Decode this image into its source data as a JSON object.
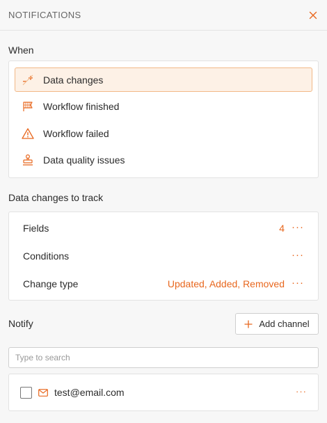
{
  "header": {
    "title": "NOTIFICATIONS",
    "close_icon": "close-icon"
  },
  "when": {
    "label": "When",
    "items": [
      {
        "label": "Data changes",
        "icon": "data-changes-icon",
        "selected": true
      },
      {
        "label": "Workflow finished",
        "icon": "flag-icon",
        "selected": false
      },
      {
        "label": "Workflow failed",
        "icon": "warning-icon",
        "selected": false
      },
      {
        "label": "Data quality issues",
        "icon": "stamp-icon",
        "selected": false
      }
    ]
  },
  "track": {
    "label": "Data changes to track",
    "rows": [
      {
        "label": "Fields",
        "value": "4"
      },
      {
        "label": "Conditions",
        "value": ""
      },
      {
        "label": "Change type",
        "value": "Updated, Added, Removed"
      }
    ],
    "more": "···"
  },
  "notify": {
    "label": "Notify",
    "add_channel_label": "Add channel",
    "search_placeholder": "Type to search",
    "channels": [
      {
        "email": "test@email.com",
        "checked": false
      }
    ]
  },
  "colors": {
    "accent": "#e8671e",
    "selected_bg": "#fdf1e6",
    "selected_border": "#f2b887"
  }
}
